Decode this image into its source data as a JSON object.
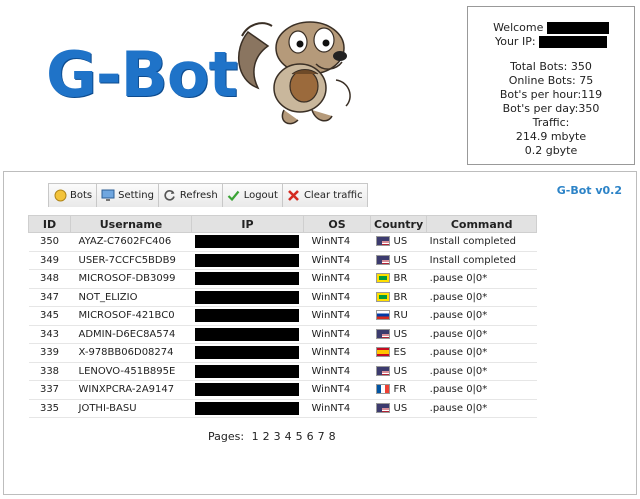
{
  "logo": {
    "text": "G-Bot"
  },
  "info": {
    "welcome_label": "Welcome",
    "ip_label": "Your IP:",
    "total_bots": "Total Bots: 350",
    "online_bots": "Online Bots: 75",
    "per_hour": "Bot's per hour:119",
    "per_day": "Bot's per day:350",
    "traffic_label": "Traffic:",
    "traffic_mb": "214.9 mbyte",
    "traffic_gb": "0.2 gbyte"
  },
  "version": "G-Bot v0.2",
  "toolbar": {
    "bots": "Bots",
    "setting": "Setting",
    "refresh": "Refresh",
    "logout": "Logout",
    "clear": "Clear traffic"
  },
  "table": {
    "headers": [
      "ID",
      "Username",
      "IP",
      "OS",
      "Country",
      "Command"
    ],
    "rows": [
      {
        "id": "350",
        "user": "AYAZ-C7602FC406",
        "os": "WinNT4",
        "country": "US",
        "cmd": "Install completed"
      },
      {
        "id": "349",
        "user": "USER-7CCFC5BDB9",
        "os": "WinNT4",
        "country": "US",
        "cmd": "Install completed"
      },
      {
        "id": "348",
        "user": "MICROSOF-DB3099",
        "os": "WinNT4",
        "country": "BR",
        "cmd": ".pause 0|0*"
      },
      {
        "id": "347",
        "user": "NOT_ELIZIO",
        "os": "WinNT4",
        "country": "BR",
        "cmd": ".pause 0|0*"
      },
      {
        "id": "345",
        "user": "MICROSOF-421BC0",
        "os": "WinNT4",
        "country": "RU",
        "cmd": ".pause 0|0*"
      },
      {
        "id": "343",
        "user": "ADMIN-D6EC8A574",
        "os": "WinNT4",
        "country": "US",
        "cmd": ".pause 0|0*"
      },
      {
        "id": "339",
        "user": "X-978BB06D08274",
        "os": "WinNT4",
        "country": "ES",
        "cmd": ".pause 0|0*"
      },
      {
        "id": "338",
        "user": "LENOVO-451B895E",
        "os": "WinNT4",
        "country": "US",
        "cmd": ".pause 0|0*"
      },
      {
        "id": "337",
        "user": "WINXPCRA-2A9147",
        "os": "WinNT4",
        "country": "FR",
        "cmd": ".pause 0|0*"
      },
      {
        "id": "335",
        "user": "JOTHI-BASU",
        "os": "WinNT4",
        "country": "US",
        "cmd": ".pause 0|0*"
      }
    ]
  },
  "pagination": {
    "label": "Pages:",
    "pages": [
      "1",
      "2",
      "3",
      "4",
      "5",
      "6",
      "7",
      "8"
    ]
  },
  "colors": {
    "brand": "#1f73c8",
    "version": "#2c83c7"
  }
}
